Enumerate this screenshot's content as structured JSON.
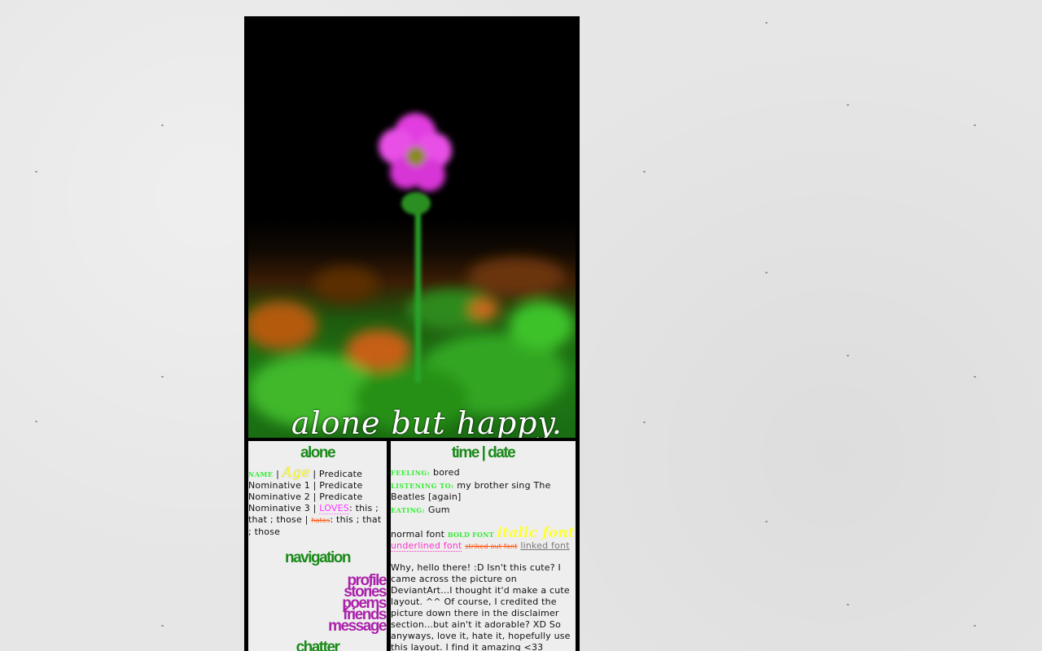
{
  "banner": {
    "title": "alone but happy."
  },
  "sidebar": {
    "about_heading": "alone",
    "about": {
      "name_label": "NAME",
      "sep1": " | ",
      "age_label": "Age",
      "sep2": " | Predicate",
      "nom1": "Nominative 1 | Predicate",
      "nom2": "Nominative 2 | Predicate",
      "nom3_prefix": "Nominative 3 | ",
      "loves_label": "LOVES",
      "loves_text": ": this ; that ; those | ",
      "hates_label": "hates",
      "hates_text": ": this ; that ; those"
    },
    "nav_heading": "navigation",
    "nav_items": [
      {
        "label": "profile"
      },
      {
        "label": "stories"
      },
      {
        "label": "poems"
      },
      {
        "label": "friends"
      },
      {
        "label": "message"
      }
    ],
    "chatter_heading": "chatter"
  },
  "content": {
    "heading": "time | date",
    "status": {
      "feeling_label": "FEELING:",
      "feeling_value": " bored",
      "listening_label": "LISTENING TO:",
      "listening_value": " my brother sing The Beatles [again]",
      "eating_label": "EATING:",
      "eating_value": " Gum"
    },
    "font_demo": {
      "normal": "normal font ",
      "bold": "BOLD FONT",
      "italic": "italic font",
      "underlined": "underlined font",
      "striked": "striked out font",
      "linked": "linked font"
    },
    "post": "Why, hello there! :D Isn't this cute? I came across the picture on DeviantArt...I thought it'd make a cute layout. ^^ Of course, I credited the picture down there in the disclaimer section...but ain't it adorable? XD So anyways, love it, hate it, hopefully use this layout. I find it amazing <33"
  },
  "colors": {
    "page_background": "#e6e6e6",
    "frame": "#000000",
    "panel_background": "#eeeeee",
    "heading_green": "#1b8a1b",
    "label_green": "#33ee33",
    "nav_purple": "#aa22aa",
    "age_yellow": "#ffff33",
    "loves_pink": "#ff33ff",
    "hates_orange": "#ff5511"
  },
  "icons": {
    "banner_art": "pink-flower-illustration"
  }
}
